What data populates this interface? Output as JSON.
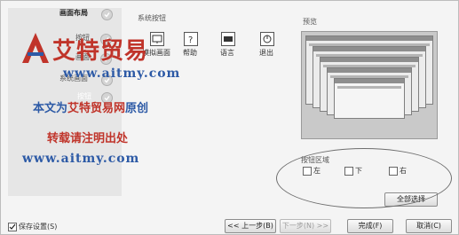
{
  "sidebar": {
    "items": [
      {
        "label": "画面布局"
      },
      {
        "label": "按钮"
      },
      {
        "label": "画面"
      },
      {
        "label": "系统画面"
      },
      {
        "label": "按钮"
      }
    ]
  },
  "system_buttons": {
    "title": "系统按钮",
    "buttons": [
      {
        "label": "模拟画面"
      },
      {
        "label": "帮助"
      },
      {
        "label": "语言"
      },
      {
        "label": "退出"
      }
    ]
  },
  "preview": {
    "title": "预览"
  },
  "button_area": {
    "title": "按钮区域",
    "options": [
      {
        "label": "左"
      },
      {
        "label": "下"
      },
      {
        "label": "右"
      }
    ],
    "select_all_label": "全部选择"
  },
  "footer": {
    "save_settings_label": "保存设置(S)",
    "back_label": "<< 上一步(B)",
    "next_label": "下一步(N) >>",
    "finish_label": "完成(F)",
    "cancel_label": "取消(C)"
  },
  "watermark": {
    "logo_text": "艾特贸易",
    "url_line1": "www.aitmy.com",
    "line_original_prefix": "本文为",
    "line_original_brand": "艾特贸易网",
    "line_original_suffix": "原创",
    "line_reprint": "转载请注明出处",
    "url_line2": "www.aitmy.com"
  },
  "colors": {
    "watermark_red": "#c0342a",
    "watermark_blue": "#2d5aa6"
  }
}
